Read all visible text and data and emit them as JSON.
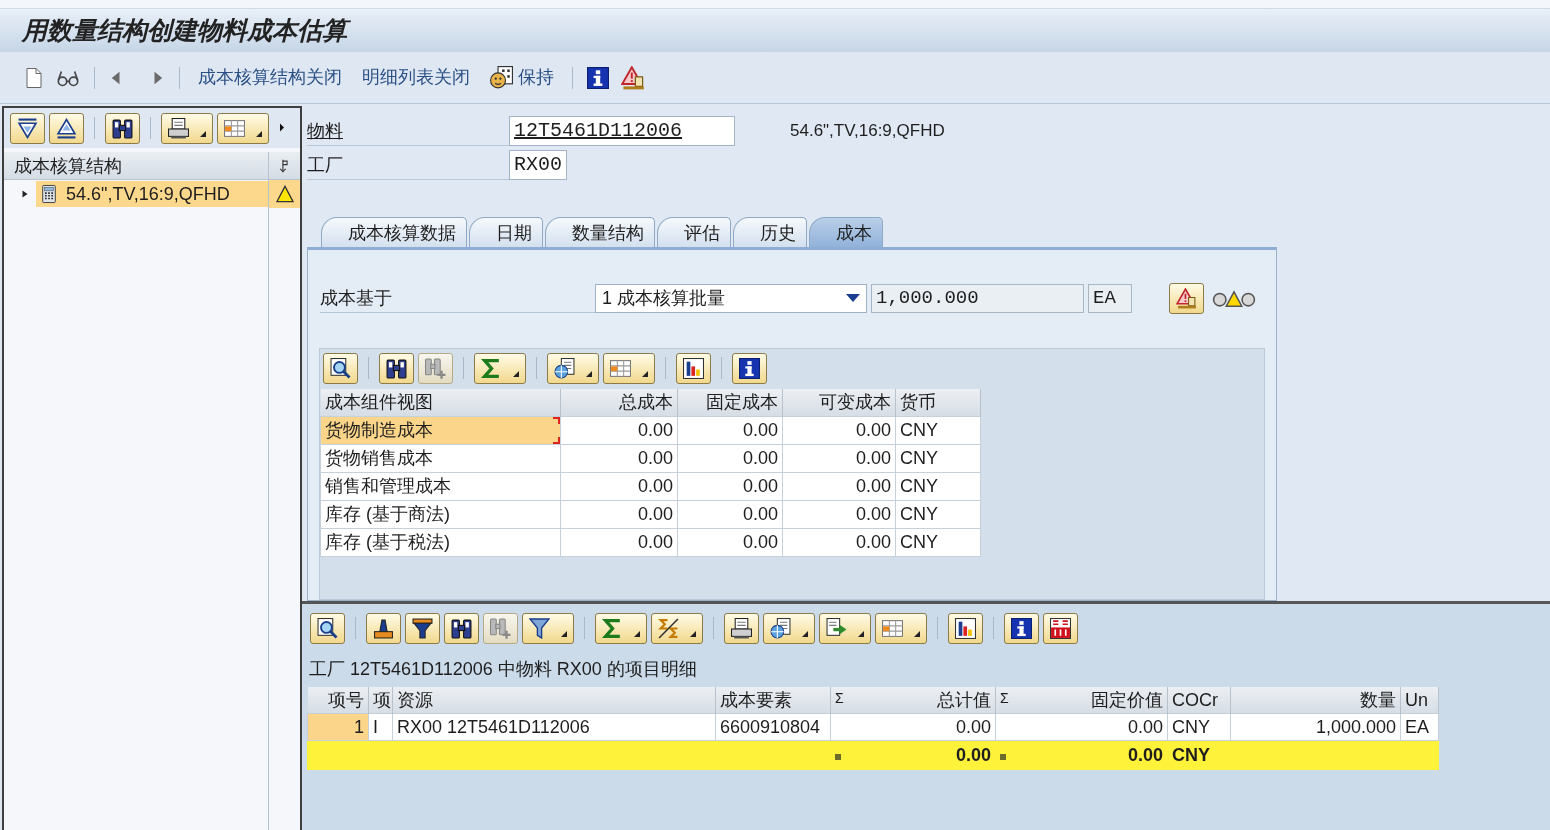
{
  "window": {
    "title": "用数量结构创建物料成本估算"
  },
  "toolbar": {
    "buttons": [
      "成本核算结构关闭",
      "明细列表关闭",
      "保持"
    ]
  },
  "tree_panel": {
    "column_header": "成本核算结构",
    "items": [
      {
        "label": "54.6\",TV,16:9,QFHD",
        "expanded": false,
        "selected": true,
        "warning": true
      }
    ]
  },
  "header_fields": [
    {
      "label": "物料",
      "value": "12T5461D112006",
      "description": "54.6\",TV,16:9,QFHD",
      "linked": true
    },
    {
      "label": "工厂",
      "value": "RX00",
      "linked": false
    }
  ],
  "tabs": [
    {
      "label": "成本核算数据",
      "selected": false
    },
    {
      "label": "日期",
      "selected": false
    },
    {
      "label": "数量结构",
      "selected": false
    },
    {
      "label": "评估",
      "selected": false
    },
    {
      "label": "历史",
      "selected": false
    },
    {
      "label": "成本",
      "selected": true
    }
  ],
  "cost_basis": {
    "label": "成本基于",
    "option": "1 成本核算批量",
    "quantity": "1,000.000",
    "unit": "EA",
    "warning": true
  },
  "cost_components": {
    "columns": [
      {
        "label": "成本组件视图",
        "kind": "text"
      },
      {
        "label": "总成本",
        "kind": "amount"
      },
      {
        "label": "固定成本",
        "kind": "amount"
      },
      {
        "label": "可变成本",
        "kind": "amount"
      },
      {
        "label": "货币",
        "kind": "text"
      }
    ],
    "rows": [
      {
        "cells": [
          "货物制造成本",
          "0.00",
          "0.00",
          "0.00",
          "CNY"
        ],
        "selected": true
      },
      {
        "cells": [
          "货物销售成本",
          "0.00",
          "0.00",
          "0.00",
          "CNY"
        ],
        "selected": false
      },
      {
        "cells": [
          "销售和管理成本",
          "0.00",
          "0.00",
          "0.00",
          "CNY"
        ],
        "selected": false
      },
      {
        "cells": [
          "库存 (基于商法)",
          "0.00",
          "0.00",
          "0.00",
          "CNY"
        ],
        "selected": false
      },
      {
        "cells": [
          "库存 (基于税法)",
          "0.00",
          "0.00",
          "0.00",
          "CNY"
        ],
        "selected": false
      }
    ]
  },
  "item_details": {
    "title": "工厂 12T5461D112006 中物料 RX00 的项目明细",
    "columns": [
      {
        "label": "项号",
        "kind": "key"
      },
      {
        "label": "项",
        "kind": "text"
      },
      {
        "label": "资源",
        "kind": "text"
      },
      {
        "label": "成本要素",
        "kind": "text"
      },
      {
        "label": "总计值",
        "kind": "amount",
        "sum_mark": "Σ",
        "total": "0.00"
      },
      {
        "label": "固定价值",
        "kind": "amount",
        "sum_mark": "Σ",
        "total": "0.00"
      },
      {
        "label": "COCr",
        "kind": "text",
        "total": "CNY"
      },
      {
        "label": "数量",
        "kind": "amount"
      },
      {
        "label": "Un",
        "kind": "text"
      }
    ],
    "rows": [
      {
        "cells": [
          "1",
          "I",
          "RX00 12T5461D112006",
          "6600910804",
          "0.00",
          "0.00",
          "CNY",
          "1,000.000",
          "EA"
        ]
      }
    ]
  }
}
